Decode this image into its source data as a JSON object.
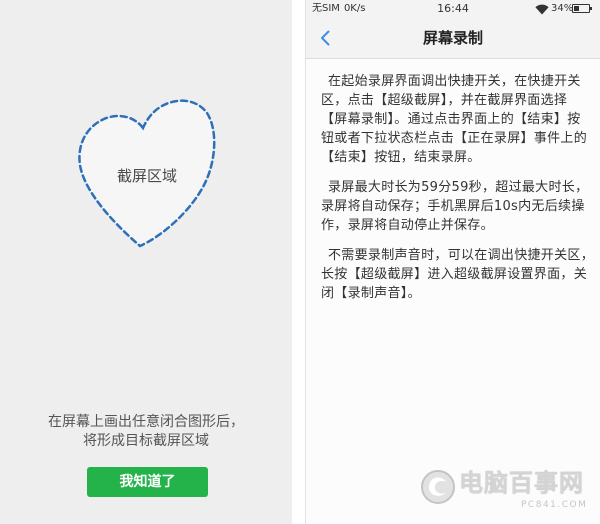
{
  "left_panel": {
    "region_label": "截屏区域",
    "hint_lines": [
      "在屏幕上画出任意闭合图形后，",
      "将形成目标截屏区域"
    ],
    "confirm_button_label": "我知道了"
  },
  "right_panel": {
    "status_bar": {
      "carrier": "无SIM",
      "network_speed": "0K/s",
      "time": "16:44",
      "battery": "34%"
    },
    "header": {
      "title": "屏幕录制"
    },
    "paragraphs": [
      [
        "在起始录屏界面调出快捷开关，在快捷开关",
        "区，点击【超级截屏】，并在截屏界面选择",
        "【屏幕录制】。通过点击界面上的【结束】按",
        "钮或者下拉状态栏点击【正在录屏】事件上的",
        "【结束】按钮，结束录屏。"
      ],
      [
        "录屏最大时长为59分59秒，超过最大时长，",
        "录屏将自动保存；手机黑屏后10s内无后续操",
        "作，录屏将自动停止并保存。"
      ],
      [
        "不需要录制声音时，可以在调出快捷开关区，",
        "长按【超级截屏】进入超级截屏设置界面，关",
        "闭【录制声音】。"
      ]
    ]
  },
  "watermark": {
    "name": "电脑百事网",
    "site": "PC841.COM"
  },
  "icons": {
    "back": "chevron-left-icon",
    "wifi": "wifi-icon",
    "battery": "battery-icon",
    "watermark_logo": "logo-icon"
  },
  "colors": {
    "region_outline": "#2d6fb8",
    "confirm_button": "#24b24b",
    "back_icon": "#3b8fe0"
  }
}
